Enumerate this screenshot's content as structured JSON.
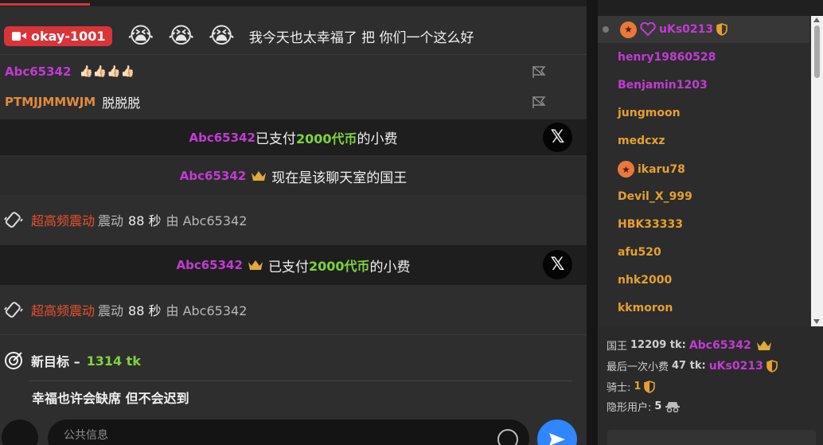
{
  "chat": {
    "host_pill": "okay-1001",
    "host_emojis": [
      "😭",
      "😭",
      "😭"
    ],
    "host_message": "我今天也太幸福了 把 你们一个这么好",
    "msg1": {
      "user": "Abc65342",
      "text": "👍🏻👍🏻👍🏻👍🏻"
    },
    "msg2": {
      "user": "PTMJJMMWJM",
      "text": "脱脱脱"
    },
    "tip1": {
      "user": "Abc65342",
      "pre": "已支付",
      "amount": "2000代币",
      "post": "的小费"
    },
    "king": {
      "user": "Abc65342",
      "text": "现在是该聊天室的国王"
    },
    "vib1": {
      "level": "超高频震动",
      "pre": "震动",
      "seconds": "88 秒",
      "by": "由 Abc65342"
    },
    "tip2": {
      "user": "Abc65342",
      "pre": "已支付",
      "amount": "2000代币",
      "post": "的小费"
    },
    "vib2": {
      "level": "超高频震动",
      "pre": "震动",
      "seconds": "88 秒",
      "by": "由 Abc65342"
    },
    "goal": {
      "label": "新目标 –",
      "amount": "1314 tk",
      "subtitle": "幸福也许会缺席 但不会迟到"
    },
    "input_placeholder": "公共信息"
  },
  "users": [
    {
      "name": "uKs0213",
      "color": "purple"
    },
    {
      "name": "henry19860528",
      "color": "purple"
    },
    {
      "name": "Benjamin1203",
      "color": "purple"
    },
    {
      "name": "jungmoon",
      "color": "orange"
    },
    {
      "name": "medcxz",
      "color": "orange"
    },
    {
      "name": "ikaru78",
      "color": "orange"
    },
    {
      "name": "Devil_X_999",
      "color": "orange"
    },
    {
      "name": "HBK33333",
      "color": "orange"
    },
    {
      "name": "afu520",
      "color": "orange"
    },
    {
      "name": "nhk2000",
      "color": "orange"
    },
    {
      "name": "kkmoron",
      "color": "orange"
    }
  ],
  "stats": {
    "king": {
      "label": "国王",
      "amount": "12209 tk:",
      "user": "Abc65342"
    },
    "last_tip": {
      "label": "最后一次小费",
      "amount": "47 tk:",
      "user": "uKs0213"
    },
    "knights": {
      "label": "骑士:",
      "value": "1"
    },
    "hidden": {
      "label": "隐形用户:",
      "value": "5"
    }
  },
  "colors": {
    "accent_red": "#d9343a",
    "purple": "#c23bd4",
    "orange": "#e6a02f",
    "green": "#7fd33a",
    "send_blue": "#2f86ff"
  }
}
